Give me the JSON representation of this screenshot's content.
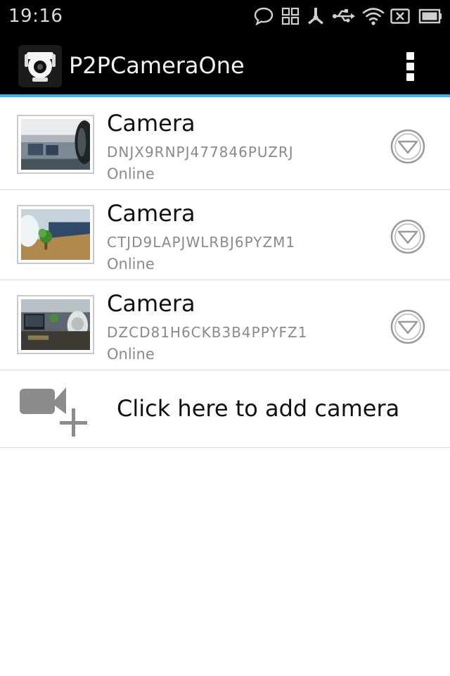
{
  "status_bar": {
    "time": "19:16",
    "icons": [
      "chat-bubble-icon",
      "grid-icon",
      "usb-debug-icon",
      "usb-icon",
      "wifi-icon",
      "no-sim-icon",
      "battery-icon"
    ]
  },
  "app_bar": {
    "title": "P2PCameraOne",
    "logo_icon": "camera-robot-logo-icon",
    "overflow_icon": "overflow-menu-icon",
    "accent_color": "#33b5e5"
  },
  "cameras": [
    {
      "name": "Camera",
      "uid": "DNJX9RNPJ477846PUZRJ",
      "status": "Online",
      "thumb_icon": "office-snapshot-1"
    },
    {
      "name": "Camera",
      "uid": "CTJD9LAPJWLRBJ6PYZM1",
      "status": "Online",
      "thumb_icon": "office-snapshot-2"
    },
    {
      "name": "Camera",
      "uid": "DZCD81H6CKB3B4PPYFZ1",
      "status": "Online",
      "thumb_icon": "office-snapshot-3"
    }
  ],
  "add_camera": {
    "label": "Click here to add camera",
    "icon": "video-camera-add-icon"
  }
}
